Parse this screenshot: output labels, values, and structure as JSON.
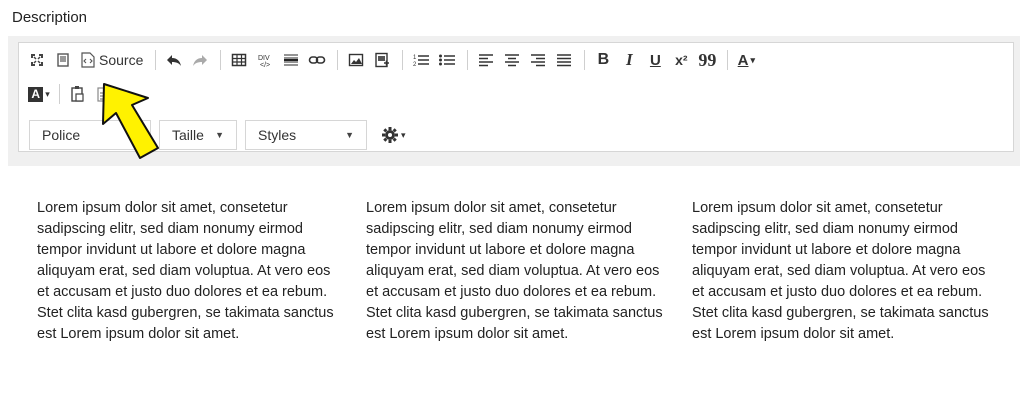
{
  "field": {
    "label": "Description"
  },
  "toolbar": {
    "source_label": "Source",
    "bold_label": "B",
    "italic_label": "I",
    "underline_label": "U",
    "superscript_label": "x²",
    "quote_label": "99",
    "font_color_label": "A",
    "bg_color_label": "A"
  },
  "selects": {
    "font": "Police",
    "size": "Taille",
    "styles": "Styles"
  },
  "content": {
    "columns": [
      "Lorem ipsum dolor sit amet, consetetur sadipscing elitr, sed diam nonumy eirmod tempor invidunt ut labore et dolore magna aliquyam erat, sed diam voluptua. At vero eos et accusam et justo duo dolores et ea rebum. Stet clita kasd gubergren, se takimata sanctus est Lorem ipsum dolor sit amet.",
      "Lorem ipsum dolor sit amet, consetetur sadipscing elitr, sed diam nonumy eirmod tempor invidunt ut labore et dolore magna aliquyam erat, sed diam voluptua. At vero eos et accusam et justo duo dolores et ea rebum. Stet clita kasd gubergren, se takimata sanctus est Lorem ipsum dolor sit amet.",
      "Lorem ipsum dolor sit amet, consetetur sadipscing elitr, sed diam nonumy eirmod tempor invidunt ut labore et dolore magna aliquyam erat, sed diam voluptua. At vero eos et accusam et justo duo dolores et ea rebum. Stet clita kasd gubergren, se takimata sanctus est Lorem ipsum dolor sit amet."
    ]
  },
  "colors": {
    "highlight_arrow": "#fff200",
    "toolbar_bg": "#f0f0f0"
  }
}
